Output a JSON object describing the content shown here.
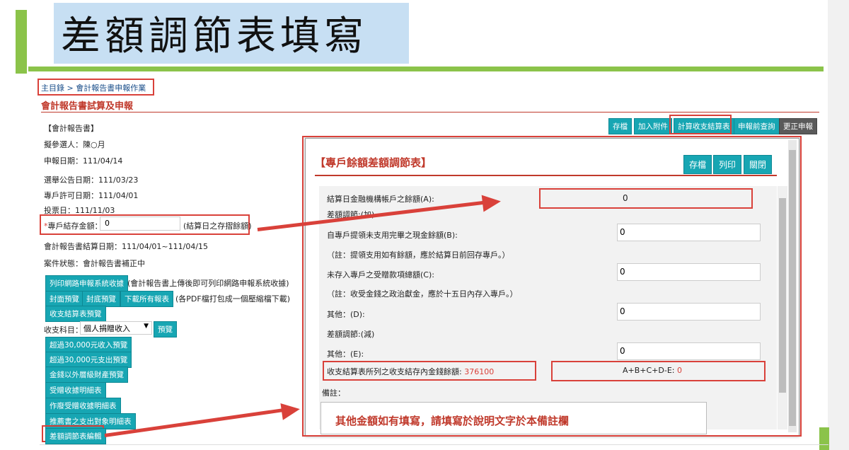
{
  "slide": {
    "title": "差額調節表填寫"
  },
  "breadcrumb": {
    "home": "主目錄",
    "sep": ">",
    "current": "會計報告書申報作業"
  },
  "page": {
    "heading": "會計報告書試算及申報"
  },
  "toolbar": {
    "save": "存檔",
    "attach": "加入附件",
    "calc": "計算收支結算表",
    "query": "申報前查詢",
    "correct": "更正申報"
  },
  "left": {
    "section": "【會計報告書】",
    "candidate": "擬參選人：陳○月",
    "apply_date": "申報日期：111/04/14",
    "announce_date": "選舉公告日期：111/03/23",
    "permit_date": "專戶許可日期：111/04/01",
    "vote_date": "投票日：111/11/03",
    "balance_label": "專戶結存金額：",
    "balance_value": "0",
    "balance_note": "(結算日之存摺餘額)",
    "period": "會計報告書結算日期：111/04/01~111/04/15",
    "status": "案件狀態：會計報告書補正中",
    "print_btn": "列印網路申報系統收據",
    "print_note": "(會計報告書上傳後即可列印網路申報系統收據)",
    "cover_btn": "封面預覽",
    "back_btn": "封底預覽",
    "download_btn": "下載所有報表",
    "download_note": "(各PDF檔打包成一個壓縮檔下載)",
    "summary_btn": "收支結算表預覽",
    "subject_label": "收支科目：",
    "subject_value": "個人捐贈收入",
    "preview_btn": "預覽",
    "links": [
      "超過30,000元收入預覽",
      "超過30,000元支出預覽",
      "金錢以外層級財產預覽",
      "受贈收據明細表",
      "作廢受贈收據明細表",
      "推薦書之支出對象明細表",
      "差額調節表編輯"
    ]
  },
  "modal": {
    "title": "【專戶餘額差額調節表】",
    "save": "存檔",
    "print": "列印",
    "close": "關閉",
    "a_label": "結算日金融機構帳戶之餘額(A):",
    "a_value": "0",
    "add_label": "差額調節:(加)",
    "b_label": "自專戶提領未支用完畢之現金餘額(B):",
    "b_value": "0",
    "b_note": "（註：提領支用如有餘額，應於結算日前回存專戶。）",
    "c_label": "未存入專戶之受贈款項總額(C):",
    "c_value": "0",
    "c_note": "（註：收受金錢之政治獻金，應於十五日內存入專戶。）",
    "d_label": "其他：(D):",
    "d_value": "0",
    "sub_label": "差額調節:(減)",
    "e_label": "其他：(E):",
    "e_value": "0",
    "total_label": "收支結算表所列之收支結存內金錢餘額:",
    "total_value": "376100",
    "formula_label": "A+B+C+D-E:",
    "formula_value": "0",
    "remark_label": "備註：",
    "remark_text": "其他金額如有填寫，請填寫於說明文字於本備註欄"
  },
  "colors": {
    "accent": "#d9413a",
    "button": "#17a6b3",
    "slide_green": "#8bc34a"
  }
}
